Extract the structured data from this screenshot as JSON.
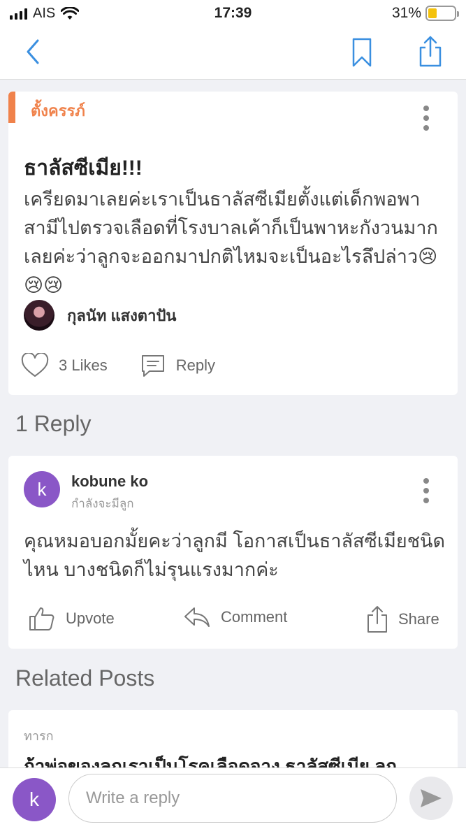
{
  "status_bar": {
    "carrier": "AIS",
    "time": "17:39",
    "battery": "31%",
    "battery_level": 0.31
  },
  "nav": {
    "back_icon": "chevron-left-icon",
    "bookmark_icon": "bookmark-icon",
    "share_icon": "share-icon",
    "accent": "#3a8fe0"
  },
  "post": {
    "category": "ตั้งครรภ์",
    "title": "ธาลัสซีเมีย!!!",
    "body": "เครียดมาเลยค่ะเราเป็นธาลัสซีเมียตั้งแต่เด็กพอพาสามีไปตรวจเลือดที่โรงบาลเค้าก็เป็นพาหะกังวนมากเลยค่ะว่าลูกจะออกมาปกติไหมจะเป็นอะไรลึปล่าว😢😢😢",
    "author": "กุลนัท แสงตาปัน",
    "likes": "3 Likes",
    "reply_label": "Reply"
  },
  "replies_heading": "1 Reply",
  "reply": {
    "avatar_letter": "k",
    "user": "kobune ko",
    "subtitle": "กำลังจะมีลูก",
    "body": "คุณหมอบอกมั้ยคะว่าลูกมี โอกาสเป็นธาลัสซีเมียชนิดไหน บางชนิดก็ไม่รุนแรงมากค่ะ",
    "upvote": "Upvote",
    "comment": "Comment",
    "share": "Share"
  },
  "related_heading": "Related Posts",
  "related": {
    "category": "ทารก",
    "title": "ถ้าพ่อของลูกเราเป็นโรคเลือดจาง ธาลัสซีเมีย ลูก"
  },
  "reply_bar": {
    "avatar_letter": "k",
    "placeholder": "Write a reply"
  },
  "colors": {
    "category": "#f0824b",
    "avatar": "#8a57c7"
  }
}
